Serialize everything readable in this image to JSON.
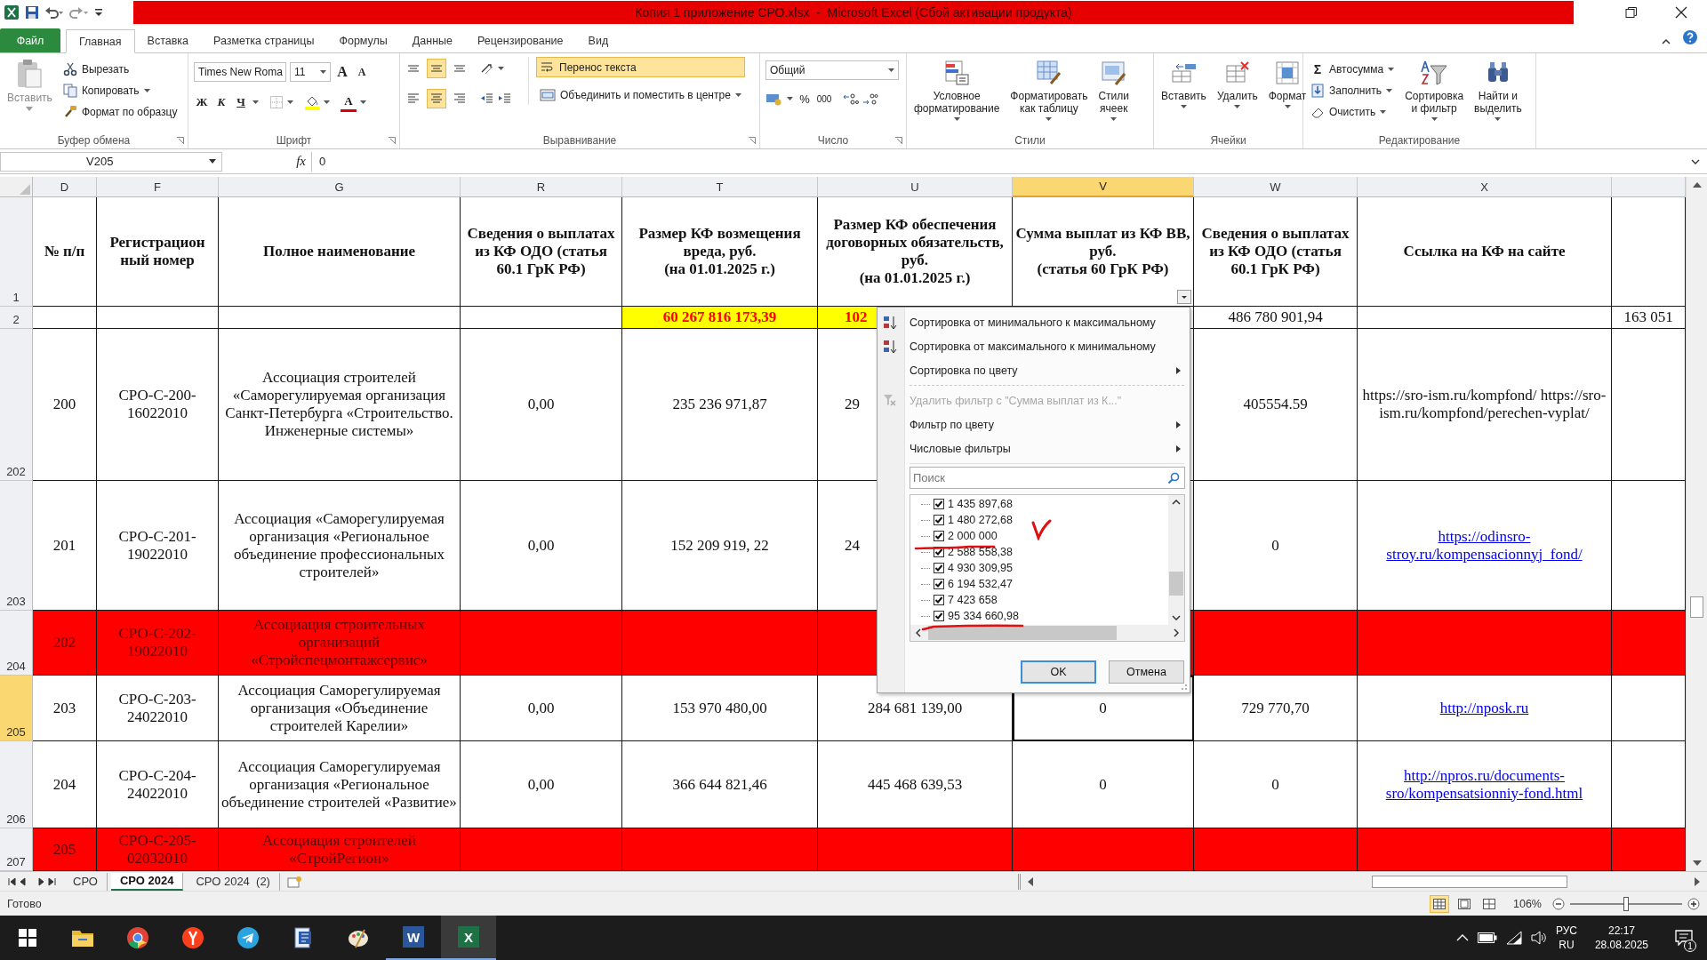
{
  "window": {
    "title": "Копия 1 приложение СРО.xlsx  -  Microsoft Excel (Сбой активации продукта)"
  },
  "ribbon_tabs": [
    {
      "label": "Файл",
      "kind": "file",
      "selected": false
    },
    {
      "label": "Главная",
      "kind": "tab",
      "selected": true
    },
    {
      "label": "Вставка",
      "kind": "tab",
      "selected": false
    },
    {
      "label": "Разметка страницы",
      "kind": "tab",
      "selected": false
    },
    {
      "label": "Формулы",
      "kind": "tab",
      "selected": false
    },
    {
      "label": "Данные",
      "kind": "tab",
      "selected": false
    },
    {
      "label": "Рецензирование",
      "kind": "tab",
      "selected": false
    },
    {
      "label": "Вид",
      "kind": "tab",
      "selected": false
    }
  ],
  "clipboard": {
    "label": "Буфер обмена",
    "paste": {
      "label": "Вставить",
      "disabled": true
    },
    "cut": "Вырезать",
    "copy": "Копировать",
    "format_painter": "Формат по образцу"
  },
  "font": {
    "label": "Шрифт",
    "family": "Times New Roma",
    "size": "11",
    "grow": "A",
    "shrink": "A",
    "bold": "Ж",
    "italic": "К",
    "underline": "Ч",
    "color_letter": "A"
  },
  "alignment": {
    "label": "Выравнивание",
    "vertical": [
      {
        "selected": false
      },
      {
        "selected": true
      },
      {
        "selected": false
      }
    ],
    "horizontal": [
      {
        "selected": false
      },
      {
        "selected": true
      },
      {
        "selected": false
      }
    ],
    "wrap_text": {
      "label": "Перенос текста",
      "on": true
    },
    "merge": "Объединить и поместить в центре"
  },
  "number": {
    "label": "Число",
    "format": "Общий",
    "percent": "%",
    "thousands": "000"
  },
  "styles": {
    "label": "Стили",
    "buttons": [
      "Условное\nформатирование",
      "Форматировать\nкак таблицу",
      "Стили\nячеек"
    ]
  },
  "cells": {
    "label": "Ячейки",
    "buttons": [
      "Вставить",
      "Удалить",
      "Формат"
    ]
  },
  "editing": {
    "label": "Редактирование",
    "sigma": "Σ",
    "autosum": "Автосумма",
    "fill": "Заполнить",
    "clear": "Очистить",
    "sort": "Сортировка\nи фильтр",
    "find": "Найти и\nвыделить"
  },
  "formula_bar": {
    "name_box": "V205",
    "fx": "fx",
    "value": "0"
  },
  "columns": [
    {
      "label": "D",
      "selected": false
    },
    {
      "label": "F",
      "selected": false
    },
    {
      "label": "G",
      "selected": false
    },
    {
      "label": "R",
      "selected": false
    },
    {
      "label": "T",
      "selected": false
    },
    {
      "label": "U",
      "selected": false
    },
    {
      "label": "V",
      "selected": true
    },
    {
      "label": "W",
      "selected": false
    },
    {
      "label": "X",
      "selected": false
    }
  ],
  "rows": [
    {
      "header": {
        "label": "1",
        "selected": false
      },
      "kind": "header",
      "cells": [
        {
          "text": "№ п/п",
          "kind": "text"
        },
        {
          "text": "Регистрацион\nный номер",
          "kind": "text"
        },
        {
          "text": "Полное наименование",
          "kind": "text"
        },
        {
          "text": "Сведения о выплатах из КФ ОДО (статья 60.1 ГрК РФ)",
          "kind": "text"
        },
        {
          "text": "Размер КФ возмещения вреда, руб.\n(на 01.01.2025 г.)",
          "kind": "text"
        },
        {
          "text": "Размер КФ обеспечения договорных обязательств, руб.\n(на 01.01.2025 г.)",
          "kind": "text"
        },
        {
          "text": "Сумма выплат из КФ ВВ, руб.\n(статья 60 ГрК РФ)",
          "kind": "filter-header"
        },
        {
          "text": "Сведения о выплатах из КФ ОДО (статья 60.1 ГрК РФ)",
          "kind": "text"
        },
        {
          "text": "Ссылка на КФ на сайте",
          "kind": "text"
        },
        null
      ]
    },
    {
      "header": {
        "label": "2",
        "selected": false
      },
      "kind": "total",
      "cells": [
        null,
        null,
        null,
        null,
        {
          "text": "60 267 816 173,39",
          "kind": "highlight"
        },
        {
          "text": "102",
          "kind": "highlight"
        },
        null,
        {
          "text": "486 780 901,94",
          "kind": "text"
        },
        null,
        {
          "text": "163 051",
          "kind": "text"
        }
      ]
    },
    {
      "header": {
        "label": "202",
        "selected": false
      },
      "kind": "entry",
      "cells": [
        {
          "text": "200",
          "kind": "text"
        },
        {
          "text": "СРО-С-200-16022010",
          "kind": "text"
        },
        {
          "text": "Ассоциация строителей «Саморегулируемая организация Санкт-Петербурга «Строительство. Инженерные системы»",
          "kind": "text"
        },
        {
          "text": "0,00",
          "kind": "text"
        },
        {
          "text": "235 236 971,87",
          "kind": "text"
        },
        {
          "text": "29",
          "kind": "text"
        },
        null,
        {
          "text": "405554.59",
          "kind": "text"
        },
        {
          "text": "https://sro-ism.ru/kompfond/ https://sro-ism.ru/kompfond/perechen-vyplat/",
          "kind": "text"
        },
        null
      ]
    },
    {
      "header": {
        "label": "203",
        "selected": false
      },
      "kind": "entry",
      "cells": [
        {
          "text": "201",
          "kind": "text"
        },
        {
          "text": "СРО-С-201-19022010",
          "kind": "text"
        },
        {
          "text": "Ассоциация «Саморегулируемая организация «Региональное объединение профессиональных строителей»",
          "kind": "text"
        },
        {
          "text": "0,00",
          "kind": "text"
        },
        {
          "text": "152 209 919, 22",
          "kind": "text"
        },
        {
          "text": "24",
          "kind": "text"
        },
        null,
        {
          "text": "0",
          "kind": "text"
        },
        {
          "text": "https://odinsro-stroy.ru/kompensacionnyj_fond/",
          "kind": "link"
        },
        null
      ]
    },
    {
      "header": {
        "label": "204",
        "selected": false
      },
      "kind": "excluded",
      "cells": [
        {
          "text": "202",
          "kind": "text"
        },
        {
          "text": "СРО-С-202-19022010",
          "kind": "text"
        },
        {
          "text": "Ассоциация строительных организаций «Стройспецмонтажсервис»",
          "kind": "text"
        },
        null,
        null,
        null,
        null,
        null,
        null,
        null
      ]
    },
    {
      "header": {
        "label": "205",
        "selected": true
      },
      "kind": "entry",
      "cells": [
        {
          "text": "203",
          "kind": "text"
        },
        {
          "text": "СРО-С-203-24022010",
          "kind": "text"
        },
        {
          "text": "Ассоциация Саморегулируемая организация «Объединение строителей Карелии»",
          "kind": "text"
        },
        {
          "text": "0,00",
          "kind": "text"
        },
        {
          "text": "153 970 480,00",
          "kind": "text"
        },
        {
          "text": "284 681 139,00",
          "kind": "text"
        },
        {
          "text": "0",
          "kind": "text"
        },
        {
          "text": "729 770,70",
          "kind": "text"
        },
        {
          "text": "http://nposk.ru",
          "kind": "link"
        },
        null
      ]
    },
    {
      "header": {
        "label": "206",
        "selected": false
      },
      "kind": "entry",
      "cells": [
        {
          "text": "204",
          "kind": "text"
        },
        {
          "text": "СРО-С-204-24022010",
          "kind": "text"
        },
        {
          "text": "Ассоциация Саморегулируемая организация «Региональное объединение строителей «Развитие»",
          "kind": "text"
        },
        {
          "text": "0,00",
          "kind": "text"
        },
        {
          "text": "366 644 821,46",
          "kind": "text"
        },
        {
          "text": "445 468 639,53",
          "kind": "text"
        },
        {
          "text": "0",
          "kind": "text"
        },
        {
          "text": "0",
          "kind": "text"
        },
        {
          "text": "http://npros.ru/documents-sro/kompensatsionniy-fond.html",
          "kind": "link"
        },
        null
      ]
    },
    {
      "header": {
        "label": "207",
        "selected": false
      },
      "kind": "excluded",
      "cells": [
        {
          "text": "205",
          "kind": "text"
        },
        {
          "text": "СРО-С-205-02032010",
          "kind": "text"
        },
        {
          "text": "Ассоциация строителей «СтройРегион»",
          "kind": "text"
        },
        null,
        null,
        null,
        null,
        null,
        null,
        null
      ]
    }
  ],
  "filter_menu": {
    "items": [
      {
        "label": "Сортировка от минимального к максимальному",
        "kind": "sort-asc",
        "disabled": false,
        "submenu": false
      },
      {
        "label": "Сортировка от максимального к минимальному",
        "kind": "sort-desc",
        "disabled": false,
        "submenu": false
      },
      {
        "label": "Сортировка по цвету",
        "kind": "plain",
        "disabled": false,
        "submenu": true
      },
      {
        "label": "Удалить фильтр с \"Сумма выплат из К...\"",
        "kind": "clear-filter",
        "disabled": true,
        "submenu": false
      },
      {
        "label": "Фильтр по цвету",
        "kind": "plain",
        "disabled": false,
        "submenu": true
      },
      {
        "label": "Числовые фильтры",
        "kind": "plain",
        "disabled": false,
        "submenu": true
      }
    ],
    "search": {
      "placeholder": "Поиск"
    },
    "values": [
      {
        "label": "1 435 897,68",
        "checked": true
      },
      {
        "label": "1 480 272,68",
        "checked": true
      },
      {
        "label": "2 000 000",
        "checked": true
      },
      {
        "label": "2 588 558,38",
        "checked": true
      },
      {
        "label": "4 930 309,95",
        "checked": true
      },
      {
        "label": "6 194 532,47",
        "checked": true
      },
      {
        "label": "7 423 658",
        "checked": true
      },
      {
        "label": "95 334 660,98",
        "checked": true
      }
    ],
    "ok": "OK",
    "cancel": "Отмена"
  },
  "sheet_tabs": [
    {
      "label": "СРО",
      "selected": false
    },
    {
      "label": "СРО 2024",
      "selected": true
    },
    {
      "label": "СРО 2024  (2)",
      "selected": false
    }
  ],
  "status": {
    "text": "Готово",
    "views": [
      {
        "selected": true
      },
      {
        "selected": false
      },
      {
        "selected": false
      }
    ],
    "zoom": "106%",
    "zoom_slider": {
      "level": 0.5
    }
  },
  "taskbar": {
    "apps": [
      {
        "kind": "start",
        "running": false,
        "selected": false
      },
      {
        "kind": "folder",
        "running": false,
        "selected": false
      },
      {
        "kind": "round",
        "running": false,
        "selected": false
      },
      {
        "kind": "red",
        "running": false,
        "selected": false
      },
      {
        "kind": "plane",
        "running": false,
        "selected": false
      },
      {
        "kind": "doc",
        "running": false,
        "selected": false
      },
      {
        "kind": "palette",
        "running": false,
        "selected": false
      },
      {
        "kind": "tile-blue",
        "glyph": "W",
        "running": true,
        "selected": false
      },
      {
        "kind": "tile-green",
        "glyph": "X",
        "running": true,
        "selected": true
      }
    ],
    "lang_top": "РУС",
    "lang_bottom": "RU",
    "time": "22:17",
    "date": "28.08.2025",
    "notifications": "1"
  }
}
